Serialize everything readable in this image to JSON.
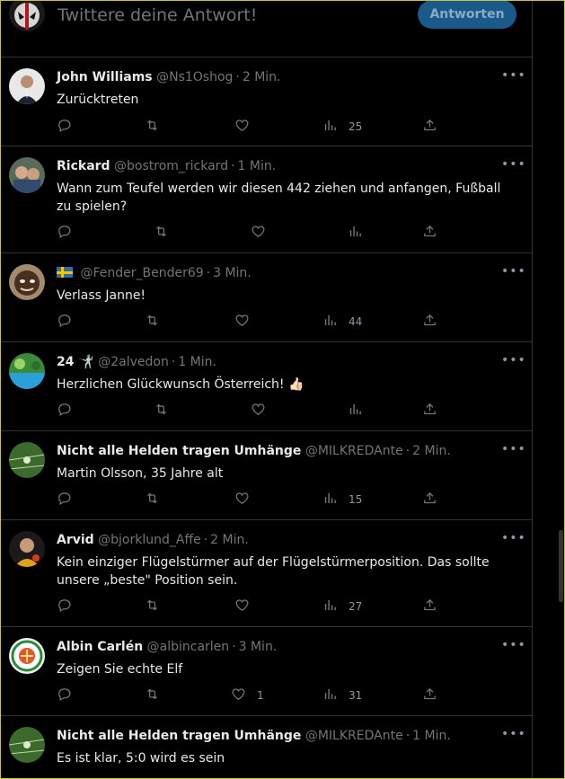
{
  "compose": {
    "placeholder": "Twittere deine Antwort!",
    "reply_label": "Antworten"
  },
  "tweets": [
    {
      "name": "John Williams",
      "handle": "@Ns1Oshog",
      "time": "2 Min.",
      "text": "Zurücktreten",
      "replies": "",
      "retweets": "",
      "likes": "",
      "views": "25"
    },
    {
      "name": "Rickard",
      "handle": "@bostrom_rickard",
      "time": "1 Min.",
      "text": "Wann zum Teufel werden wir diesen 442 ziehen und anfangen, Fußball zu spielen?",
      "replies": "",
      "retweets": "",
      "likes": "",
      "views": ""
    },
    {
      "name": "",
      "handle": "@Fender_Bender69",
      "time": "3 Min.",
      "text": "Verlass Janne!",
      "replies": "",
      "retweets": "",
      "likes": "",
      "views": "44"
    },
    {
      "name": "24 🤺",
      "handle": "@2alvedon",
      "time": "1 Min.",
      "text": "Herzlichen Glückwunsch Österreich! 👍🏻",
      "replies": "",
      "retweets": "",
      "likes": "",
      "views": ""
    },
    {
      "name": "Nicht alle Helden tragen Umhänge",
      "handle": "@MILKREDAnte",
      "time": "2 Min.",
      "text": "Martin Olsson, 35 Jahre alt",
      "replies": "",
      "retweets": "",
      "likes": "",
      "views": "15"
    },
    {
      "name": "Arvid",
      "handle": "@bjorklund_Affe",
      "time": "2 Min.",
      "text": "Kein einziger Flügelstürmer auf der Flügelstürmerposition. Das sollte unsere „beste\" Position sein.",
      "replies": "",
      "retweets": "",
      "likes": "",
      "views": "27"
    },
    {
      "name": "Albin Carlén",
      "handle": "@albincarlen",
      "time": "3 Min.",
      "text": "Zeigen Sie echte Elf",
      "replies": "",
      "retweets": "",
      "likes": "1",
      "views": "31"
    },
    {
      "name": "Nicht alle Helden tragen Umhänge",
      "handle": "@MILKREDAnte",
      "time": "1 Min.",
      "text": "Es ist klar, 5:0 wird es sein",
      "replies": "",
      "retweets": "",
      "likes": "",
      "views": ""
    }
  ],
  "icons": [
    "reply-icon",
    "retweet-icon",
    "like-icon",
    "views-icon",
    "share-icon",
    "more-icon"
  ],
  "colors": {
    "background": "#000000",
    "reply_button": "#1a5a8a",
    "muted": "#71767b",
    "divider": "#2f3336"
  }
}
